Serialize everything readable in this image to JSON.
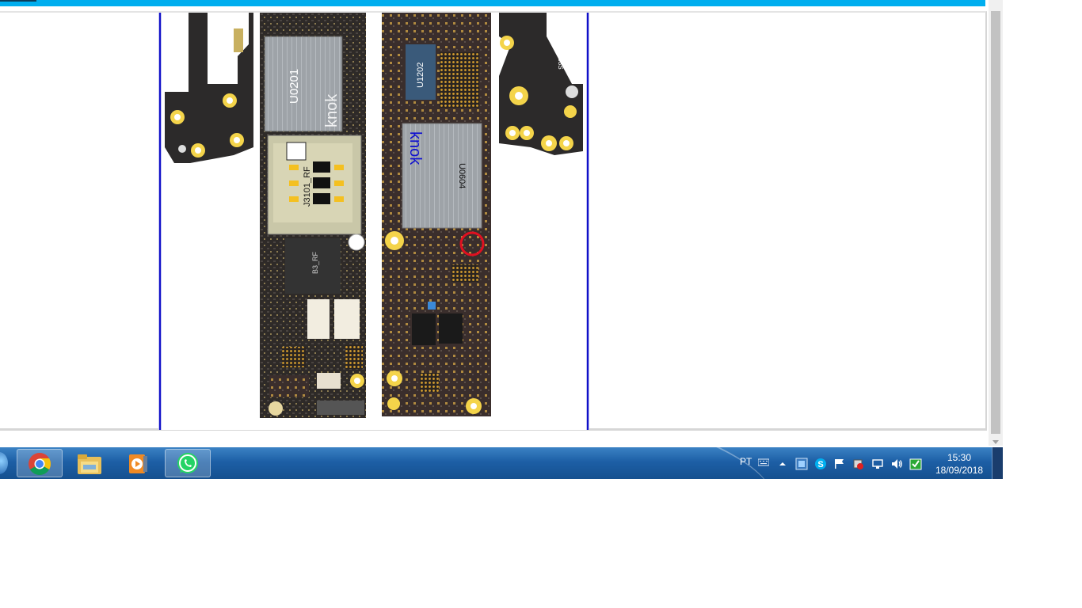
{
  "browser": {
    "page_image_alt": "iPhone logic board diagram",
    "labels": {
      "u0201": "U0201",
      "knok_left": "knok",
      "j3101": "J3101_RF",
      "b3rf": "B3_RF",
      "u1202": "U1202",
      "knok_right": "knok",
      "u0604": "U0604",
      "t308s": "T308S"
    }
  },
  "taskbar": {
    "apps": [
      {
        "name": "Google Chrome",
        "icon": "chrome-icon"
      },
      {
        "name": "Windows Explorer",
        "icon": "folder-icon"
      },
      {
        "name": "Media Player",
        "icon": "media-player-icon"
      },
      {
        "name": "WhatsApp",
        "icon": "whatsapp-icon"
      }
    ],
    "tray": {
      "language": "PT",
      "time": "15:30",
      "date": "18/09/2018"
    }
  },
  "colors": {
    "accent_bar": "#00aeef",
    "taskbar": "#1d5fa6",
    "frame_line": "#1010c8",
    "highlight_circle": "#e01020"
  }
}
